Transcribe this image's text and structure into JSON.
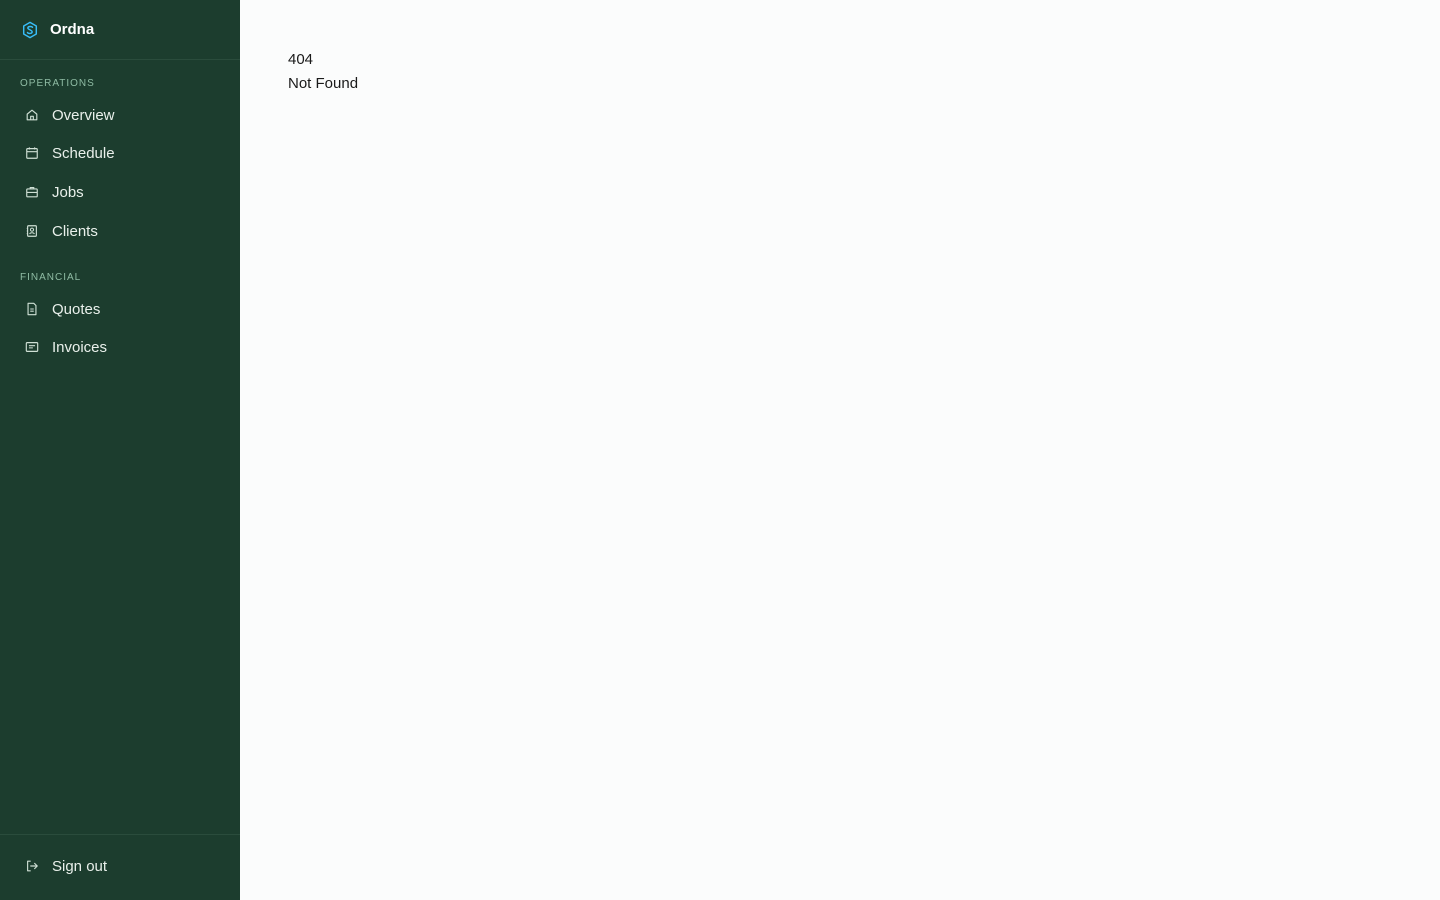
{
  "brand": {
    "name": "Ordna",
    "logo_icon": "logo-s-icon",
    "accent": "#38bdf8"
  },
  "sidebar": {
    "sections": [
      {
        "label": "Operations"
      },
      {
        "label": "Financial"
      }
    ],
    "items": [
      {
        "label": "Overview",
        "icon": "home-icon"
      },
      {
        "label": "Schedule",
        "icon": "calendar-icon"
      },
      {
        "label": "Jobs",
        "icon": "briefcase-icon"
      },
      {
        "label": "Clients",
        "icon": "contact-icon"
      },
      {
        "label": "Quotes",
        "icon": "document-icon"
      },
      {
        "label": "Invoices",
        "icon": "receipt-icon"
      }
    ],
    "footer": {
      "signout_label": "Sign out",
      "icon": "logout-icon"
    }
  },
  "main": {
    "status_code": "404",
    "message": "Not Found"
  },
  "colors": {
    "sidebar_bg": "#1c3d2e",
    "main_bg": "#fbfcfc",
    "section_label": "#8fbca4"
  }
}
